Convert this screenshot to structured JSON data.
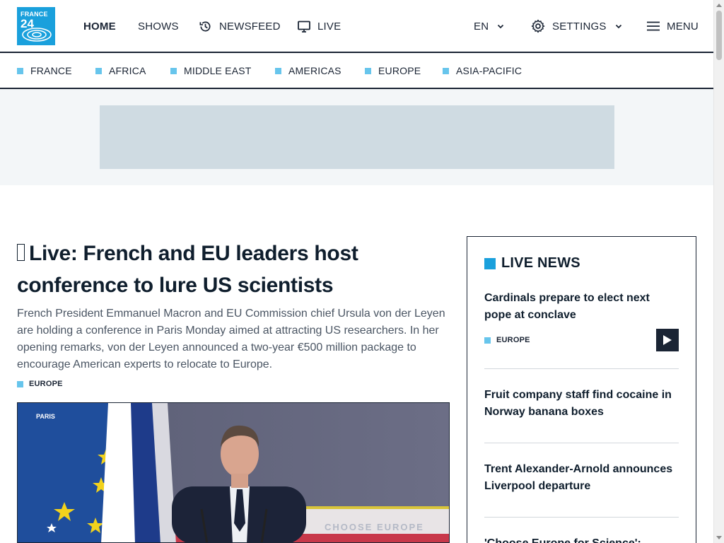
{
  "logo": {
    "line1": "FRANCE",
    "line2": "24"
  },
  "header": {
    "home": "HOME",
    "shows": "SHOWS",
    "newsfeed": "NEWSFEED",
    "live": "LIVE",
    "language": "EN",
    "settings": "SETTINGS",
    "menu": "MENU"
  },
  "regions": [
    "FRANCE",
    "AFRICA",
    "MIDDLE EAST",
    "AMERICAS",
    "EUROPE",
    "ASIA-PACIFIC"
  ],
  "main": {
    "headline_icon": "live-icon",
    "headline": "Live: French and EU leaders host conference to lure US scientists",
    "summary": "French President Emmanuel Macron and EU Commission chief Ursula von der Leyen are holding a conference in Paris Monday aimed at attracting US researchers. In her opening remarks, von der Leyen announced a two-year €500 million package to encourage American experts to relocate to Europe.",
    "tag": "EUROPE",
    "image_caption": "PARIS",
    "image_banner": "CHOOSE EUROPE"
  },
  "live_news": {
    "heading": "LIVE NEWS",
    "items": [
      {
        "title": "Cardinals prepare to elect next pope at conclave",
        "tag": "EUROPE"
      },
      {
        "title": "Fruit company staff find cocaine in Norway banana boxes"
      },
      {
        "title": "Trent Alexander-Arnold announces Liverpool departure"
      },
      {
        "title": "'Choose Europe for Science':"
      }
    ]
  },
  "colors": {
    "accent": "#1aa0dc",
    "tag_square": "#67c5ec",
    "dark": "#1a2434",
    "ad_bg": "#cfdbe2"
  }
}
